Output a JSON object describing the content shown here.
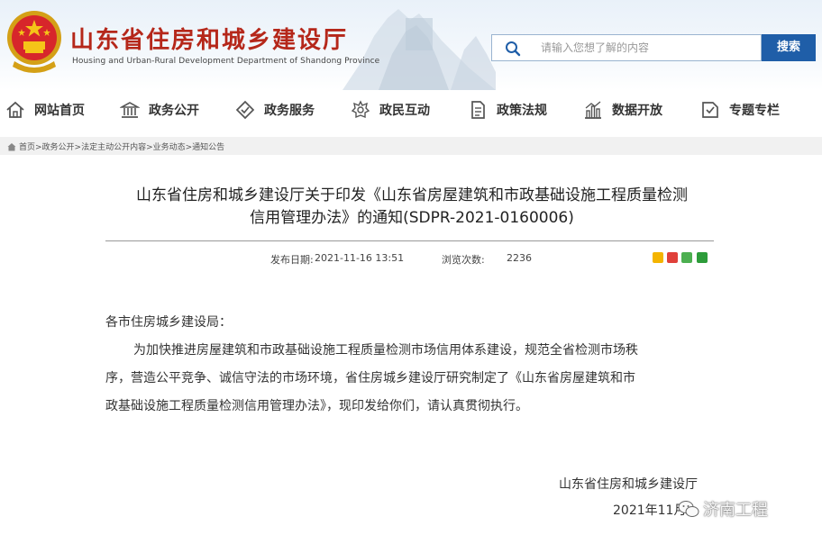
{
  "header": {
    "title": "山东省住房和城乡建设厅",
    "subtitle": "Housing and Urban-Rural Development Department of Shandong Province",
    "search_placeholder": "请输入您想了解的内容",
    "search_button": "搜索"
  },
  "nav": {
    "items": [
      {
        "label": "网站首页",
        "icon": "home-icon"
      },
      {
        "label": "政务公开",
        "icon": "government-building-icon"
      },
      {
        "label": "政务服务",
        "icon": "service-diamond-icon"
      },
      {
        "label": "政民互动",
        "icon": "interaction-icon"
      },
      {
        "label": "政策法规",
        "icon": "document-icon"
      },
      {
        "label": "数据开放",
        "icon": "bar-chart-icon"
      },
      {
        "label": "专题专栏",
        "icon": "topic-icon"
      }
    ]
  },
  "breadcrumb": {
    "text": "首页>政务公开>法定主动公开内容>业务动态>通知公告"
  },
  "article": {
    "title_line1": "山东省住房和城乡建设厅关于印发《山东省房屋建筑和市政基础设施工程质量检测",
    "title_line2": "信用管理办法》的通知(SDPR-2021-0160006)",
    "publish_label": "发布日期:",
    "publish_date": "2021-11-16 13:51",
    "views_label": "浏览次数:",
    "views": "2236",
    "salutation": "各市住房城乡建设局：",
    "para_line1": "为加快推进房屋建筑和市政基础设施工程质量检测市场信用体系建设，规范全省检测市场秩",
    "para_line2": "序，营造公平竞争、诚信守法的市场环境，省住房城乡建设厅研究制定了《山东省房屋建筑和市",
    "para_line3": "政基础设施工程质量检测信用管理办法》，现印发给你们，请认真贯彻执行。",
    "signature": "山东省住房和城乡建设厅",
    "sign_date": "2021年11月"
  },
  "watermark": {
    "text": "济南工程"
  },
  "colors": {
    "title_red": "#b5271a",
    "search_blue": "#1f5ea8"
  }
}
